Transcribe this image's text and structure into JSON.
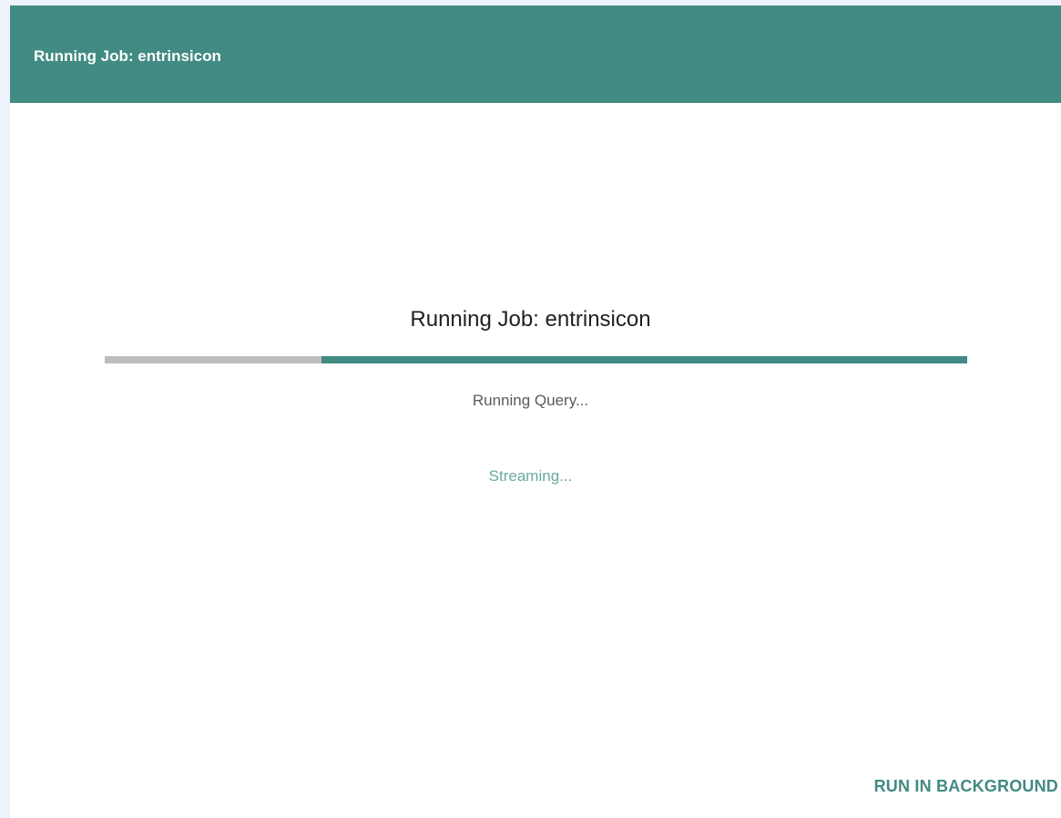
{
  "header": {
    "title": "Running Job: entrinsicon"
  },
  "job": {
    "title": "Running Job: entrinsicon",
    "progress_fraction": 0.749,
    "status": "Running Query...",
    "stream_status": "Streaming..."
  },
  "actions": {
    "run_in_background_label": "RUN IN BACKGROUND"
  },
  "colors": {
    "accent": "#418b82",
    "track": "#bdbdbd",
    "stream_text": "#6aaa9f",
    "page_background": "#edf3fb"
  }
}
